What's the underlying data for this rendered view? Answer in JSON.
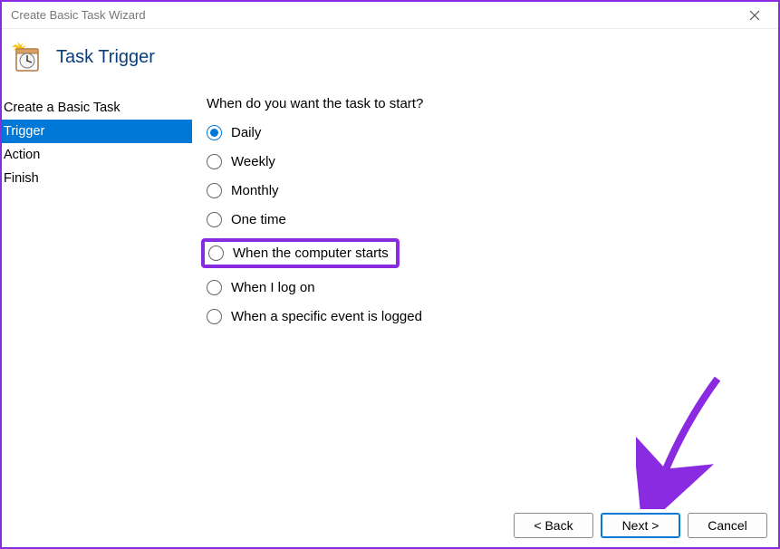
{
  "window": {
    "title": "Create Basic Task Wizard"
  },
  "header": {
    "heading": "Task Trigger"
  },
  "sidebar": {
    "steps": [
      {
        "label": "Create a Basic Task",
        "selected": false
      },
      {
        "label": "Trigger",
        "selected": true
      },
      {
        "label": "Action",
        "selected": false
      },
      {
        "label": "Finish",
        "selected": false
      }
    ]
  },
  "content": {
    "prompt": "When do you want the task to start?",
    "options": [
      "Daily",
      "Weekly",
      "Monthly",
      "One time",
      "When the computer starts",
      "When I log on",
      "When a specific event is logged"
    ],
    "selected": "Daily",
    "highlighted": "When the computer starts"
  },
  "footer": {
    "back": "< Back",
    "next": "Next >",
    "cancel": "Cancel"
  },
  "annotation": {
    "color": "#8a2be2"
  }
}
